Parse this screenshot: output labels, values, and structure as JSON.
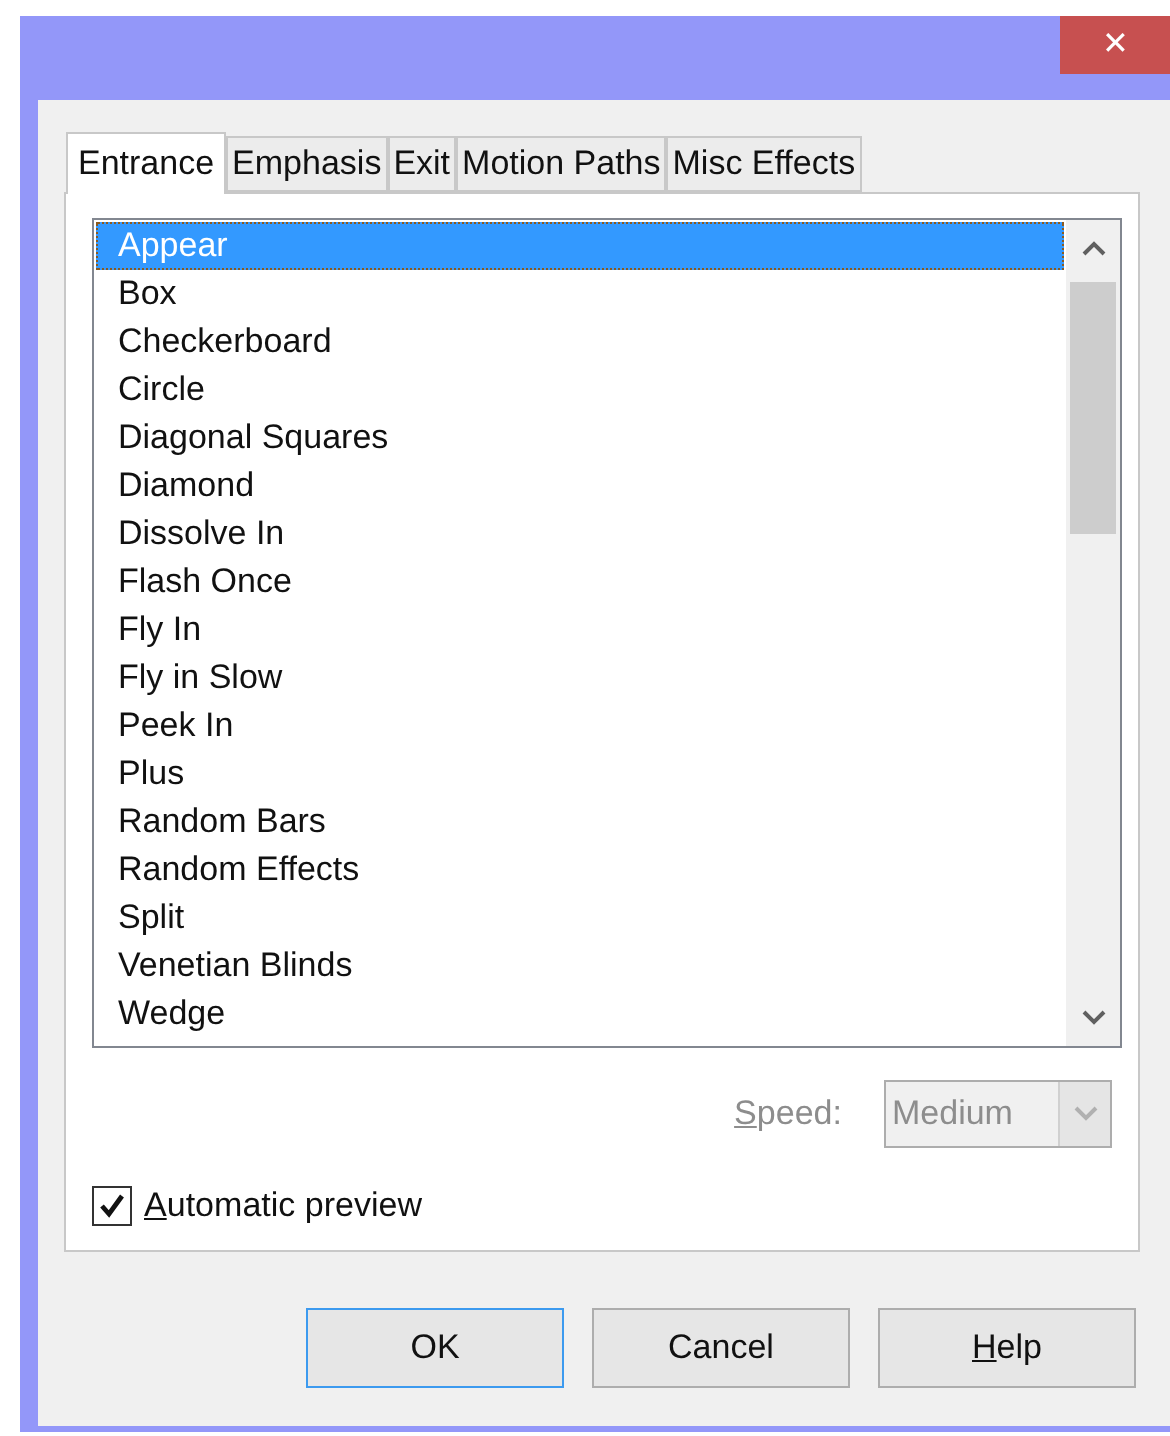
{
  "window": {
    "close": "✕"
  },
  "tabs": [
    {
      "label": "Entrance",
      "selected": true
    },
    {
      "label": "Emphasis",
      "selected": false
    },
    {
      "label": "Exit",
      "selected": false
    },
    {
      "label": "Motion Paths",
      "selected": false
    },
    {
      "label": "Misc Effects",
      "selected": false
    }
  ],
  "effects": [
    {
      "label": "Appear",
      "selected": true
    },
    {
      "label": "Box",
      "selected": false
    },
    {
      "label": "Checkerboard",
      "selected": false
    },
    {
      "label": "Circle",
      "selected": false
    },
    {
      "label": "Diagonal Squares",
      "selected": false
    },
    {
      "label": "Diamond",
      "selected": false
    },
    {
      "label": "Dissolve In",
      "selected": false
    },
    {
      "label": "Flash Once",
      "selected": false
    },
    {
      "label": "Fly In",
      "selected": false
    },
    {
      "label": "Fly in Slow",
      "selected": false
    },
    {
      "label": "Peek In",
      "selected": false
    },
    {
      "label": "Plus",
      "selected": false
    },
    {
      "label": "Random Bars",
      "selected": false
    },
    {
      "label": "Random Effects",
      "selected": false
    },
    {
      "label": "Split",
      "selected": false
    },
    {
      "label": "Venetian Blinds",
      "selected": false
    },
    {
      "label": "Wedge",
      "selected": false
    }
  ],
  "speed": {
    "label": "Speed:",
    "value": "Medium",
    "disabled": true
  },
  "automatic_preview": {
    "label": "Automatic preview",
    "checked": true
  },
  "buttons": [
    {
      "label": "OK",
      "default": true
    },
    {
      "label": "Cancel",
      "default": false
    },
    {
      "label": "Help",
      "default": false
    }
  ]
}
